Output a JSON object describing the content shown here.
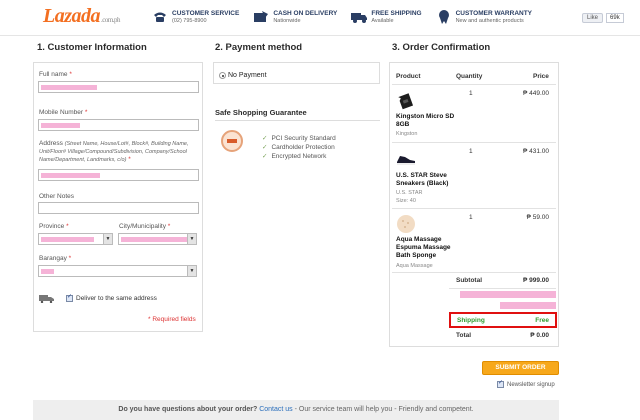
{
  "header": {
    "logo": "Lazada",
    "logo_suffix": ".com.ph",
    "features": [
      {
        "icon": "phone-icon",
        "title": "Customer Service",
        "sub": "(02) 795-8900"
      },
      {
        "icon": "cash-on-delivery-icon",
        "title": "Cash on Delivery",
        "sub": "Nationwide"
      },
      {
        "icon": "truck-icon",
        "title": "Free Shipping",
        "sub": "Available"
      },
      {
        "icon": "warranty-badge-icon",
        "title": "Customer Warranty",
        "sub": "New and authentic products"
      }
    ],
    "like_label": "Like",
    "like_count": "69k"
  },
  "sections": {
    "customer": "1. Customer Information",
    "payment": "2. Payment method",
    "confirmation": "3. Order Confirmation"
  },
  "customer_form": {
    "full_name_label": "Full name",
    "mobile_label": "Mobile Number",
    "address_label": "Address",
    "address_hint": "(Street Name, House/Lot#, Block#, Building Name, Unit/Floor# Village/Compound/Subdivision, Company/School Name/Department, Landmarks, c/o)",
    "other_notes_label": "Other Notes",
    "province_label": "Province",
    "city_label": "City/Municipality",
    "barangay_label": "Barangay",
    "deliver_same": "Deliver to the same address",
    "required_note": "Required fields",
    "required_star": "*"
  },
  "payment": {
    "option": "No Payment",
    "safe_title": "Safe Shopping Guarantee",
    "bullets": [
      "PCI Security Standard",
      "Cardholder Protection",
      "Encrypted Network"
    ]
  },
  "order": {
    "headers": {
      "product": "Product",
      "quantity": "Quantity",
      "price": "Price"
    },
    "items": [
      {
        "name": "Kingston Micro SD 8GB",
        "brand": "Kingston",
        "qty": "1",
        "price": "₱ 449.00"
      },
      {
        "name": "U.S. STAR Steve Sneakers (Black)",
        "brand": "U.S. STAR",
        "size": "Size: 40",
        "qty": "1",
        "price": "₱ 431.00"
      },
      {
        "name": "Aqua Massage Espuma Massage Bath Sponge",
        "brand": "Aqua Massage",
        "qty": "1",
        "price": "₱ 59.00"
      }
    ],
    "subtotal_label": "Subtotal",
    "subtotal": "₱ 999.00",
    "shipping_label": "Shipping",
    "shipping": "Free",
    "total_label": "Total",
    "total": "₱ 0.00",
    "submit": "SUBMIT ORDER",
    "newsletter": "Newsletter signup"
  },
  "footer": {
    "question": "Do you have questions about your order?",
    "link": "Contact us",
    "rest": "- Our service team will help you - Friendly and competent."
  },
  "colors": {
    "brand": "#f36f21",
    "submit": "#f7a81b",
    "shipping": "#2e9c2e",
    "highlight": "#e01010"
  }
}
